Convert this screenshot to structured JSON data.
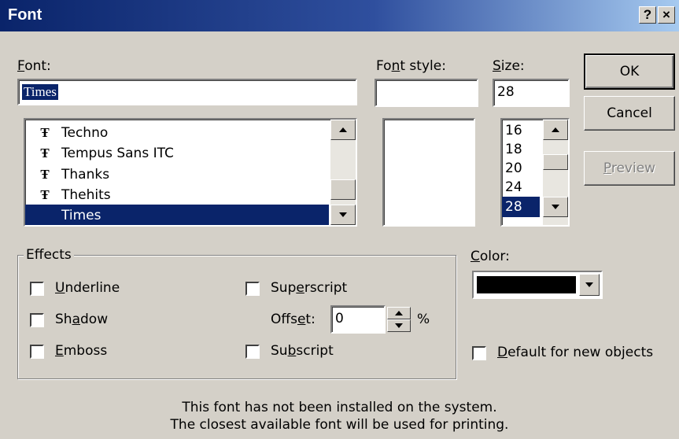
{
  "titlebar": {
    "title": "Font",
    "help": "?",
    "close": "×"
  },
  "font": {
    "label_pre": "",
    "label_key": "F",
    "label_post": "ont:",
    "value": "Times",
    "items": [
      "Techno",
      "Tempus Sans ITC",
      "Thanks",
      "Thehits",
      "Times"
    ],
    "selected_index": 4,
    "item_icon": "T-truetype-icon"
  },
  "font_style": {
    "label_pre": "Fo",
    "label_key": "n",
    "label_post": "t style:",
    "value": ""
  },
  "size": {
    "label_pre": "",
    "label_key": "S",
    "label_post": "ize:",
    "value": "28",
    "items": [
      "16",
      "18",
      "20",
      "24",
      "28"
    ],
    "selected_index": 4
  },
  "buttons": {
    "ok": "OK",
    "cancel": "Cancel",
    "preview_key": "P",
    "preview_rest": "review"
  },
  "effects": {
    "title": "Effects",
    "underline": {
      "pre": "",
      "key": "U",
      "post": "nderline",
      "checked": false
    },
    "shadow": {
      "pre": "Sh",
      "key": "a",
      "post": "dow",
      "checked": false
    },
    "emboss": {
      "pre": "",
      "key": "E",
      "post": "mboss",
      "checked": false
    },
    "superscript": {
      "pre": "Sup",
      "key": "e",
      "post": "rscript",
      "checked": false
    },
    "offset": {
      "pre": "Offs",
      "key": "e",
      "post": "t:",
      "value": "0",
      "unit": "%"
    },
    "subscript": {
      "pre": "Su",
      "key": "b",
      "post": "script",
      "checked": false
    }
  },
  "color": {
    "label_pre": "",
    "label_key": "C",
    "label_post": "olor:",
    "value_hex": "#000000"
  },
  "default_new": {
    "pre": "",
    "key": "D",
    "post": "efault for new objects",
    "checked": false
  },
  "message": {
    "line1": "This font has not been installed on the system.",
    "line2": "The closest available font will be used for printing."
  },
  "colors": {
    "title_start": "#0a246a",
    "title_end": "#a6caf0",
    "face": "#d4d0c8",
    "selection": "#0a246a"
  }
}
